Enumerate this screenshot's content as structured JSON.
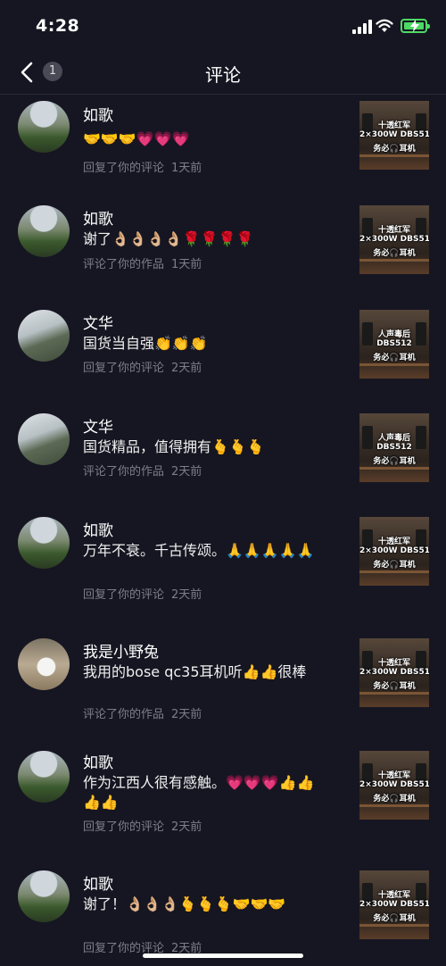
{
  "status_bar": {
    "time": "4:28"
  },
  "nav": {
    "title": "评论",
    "badge": "1"
  },
  "items": [
    {
      "user": "如歌",
      "text": "🤝🤝🤝💗💗💗",
      "action": "回复了你的评论",
      "time": "1天前",
      "thumb": [
        "十透红军",
        "2×300W DBS512",
        "务必🎧耳机"
      ]
    },
    {
      "user": "如歌",
      "text": "谢了👌🏼👌🏼👌🏼👌🏼🌹🌹🌹🌹",
      "action": "评论了你的作品",
      "time": "1天前",
      "thumb": [
        "十透红军",
        "2×300W DBS512",
        "务必🎧耳机"
      ]
    },
    {
      "user": "文华",
      "text": "国货当自强👏👏👏",
      "action": "回复了你的评论",
      "time": "2天前",
      "thumb": [
        "人声毒后",
        "DBS512",
        "务必🎧耳机"
      ]
    },
    {
      "user": "文华",
      "text": "国货精品，值得拥有🫰🫰🫰",
      "action": "评论了你的作品",
      "time": "2天前",
      "thumb": [
        "人声毒后",
        "DBS512",
        "务必🎧耳机"
      ]
    },
    {
      "user": "如歌",
      "text": "万年不衰。千古传颂。🙏🙏🙏🙏🙏",
      "action": "回复了你的评论",
      "time": "2天前",
      "thumb": [
        "十透红军",
        "2×300W DBS512",
        "务必🎧耳机"
      ]
    },
    {
      "user": "我是小野兔",
      "text": "我用的bose qc35耳机听👍👍很棒",
      "action": "评论了你的作品",
      "time": "2天前",
      "thumb": [
        "十透红军",
        "2×300W DBS512",
        "务必🎧耳机"
      ]
    },
    {
      "user": "如歌",
      "text": "作为江西人很有感触。💗💗💗👍👍👍👍",
      "action": "回复了你的评论",
      "time": "2天前",
      "thumb": [
        "十透红军",
        "2×300W DBS512",
        "务必🎧耳机"
      ]
    },
    {
      "user": "如歌",
      "text": "谢了！👌🏼👌🏼👌🏼🫰🫰🫰🤝🤝🤝",
      "action": "回复了你的评论",
      "time": "2天前",
      "thumb": [
        "十透红军",
        "2×300W DBS512",
        "务必🎧耳机"
      ]
    }
  ]
}
